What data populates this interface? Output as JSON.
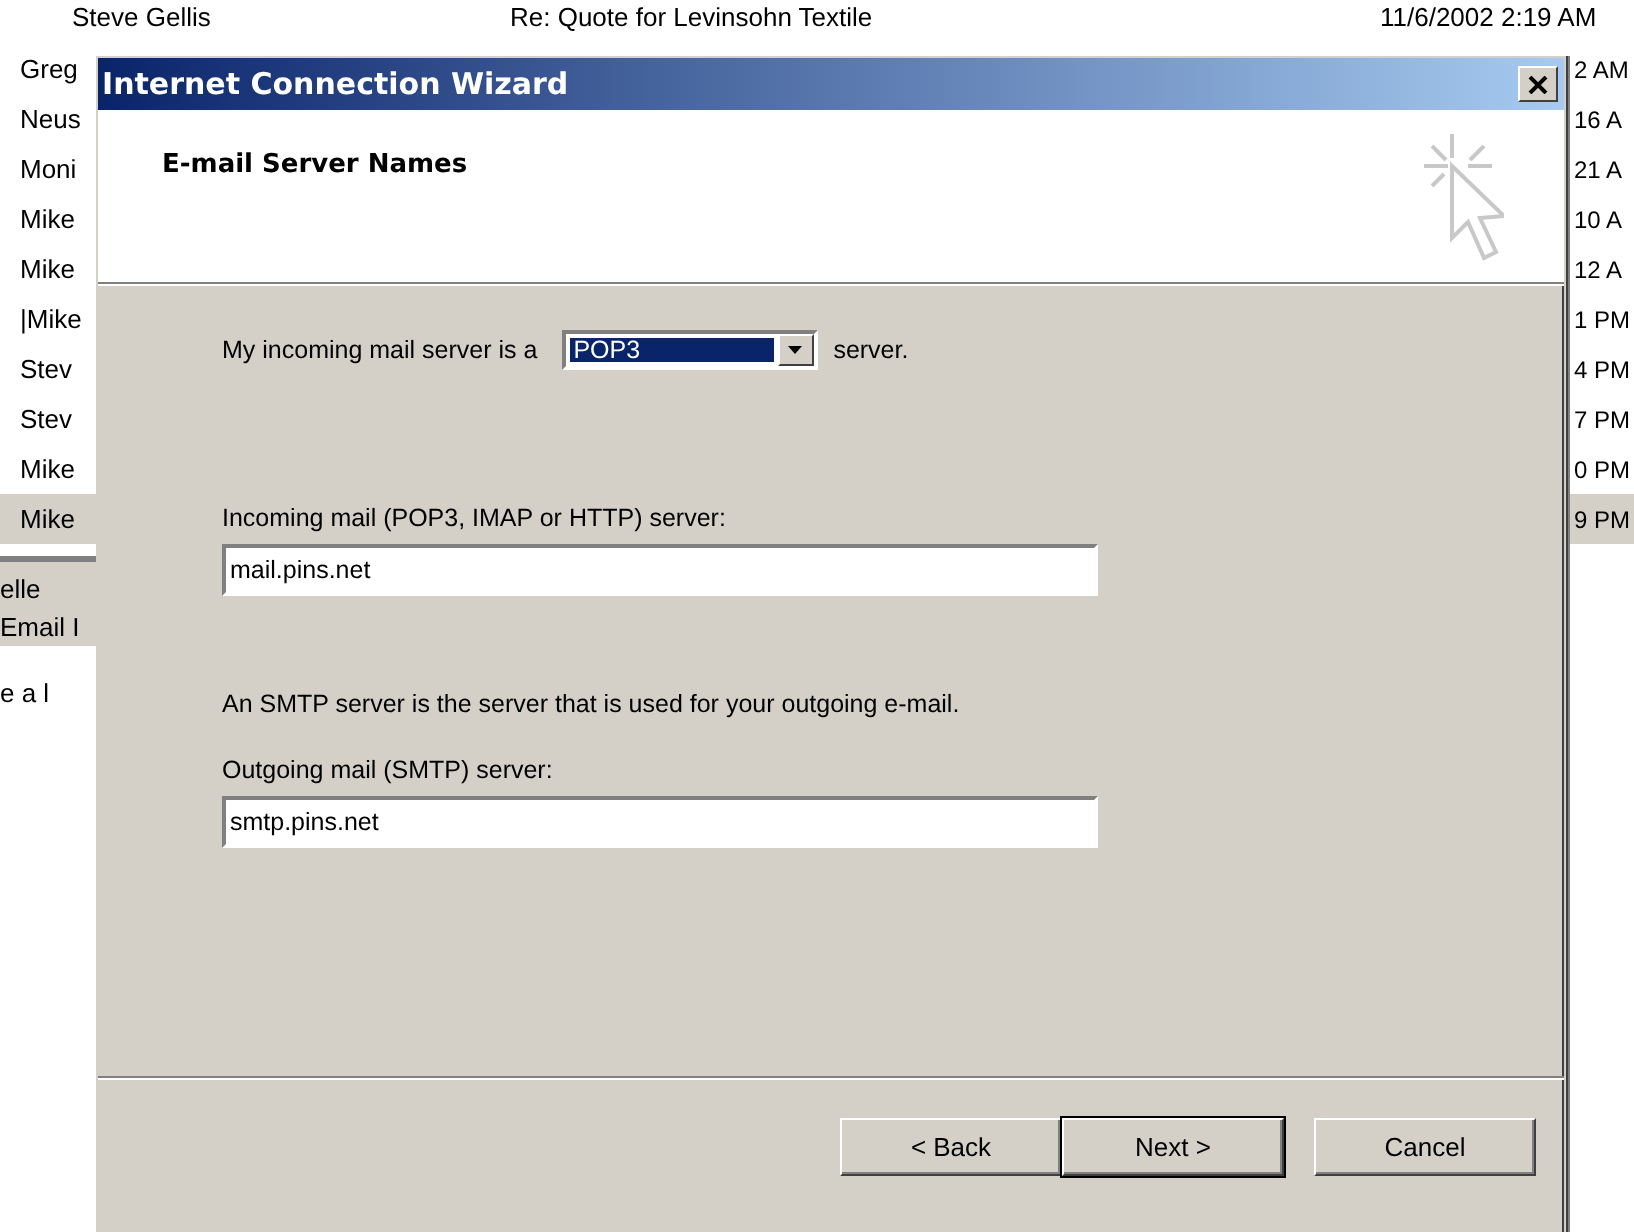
{
  "background": {
    "header_row": {
      "sender": "Steve Gellis",
      "subject": "Re: Quote for Levinsohn Textile",
      "received": "11/6/2002 2:19 AM"
    },
    "rows": [
      {
        "sender": "Greg",
        "received": "2 AM",
        "selected": false
      },
      {
        "sender": "Neus",
        "received": "16 A",
        "selected": false
      },
      {
        "sender": "Moni",
        "received": "21 A",
        "selected": false
      },
      {
        "sender": "Mike",
        "received": "10 A",
        "selected": false
      },
      {
        "sender": "Mike",
        "received": "12 A",
        "selected": false
      },
      {
        "sender": "|Mike",
        "received": "1 PM",
        "selected": false
      },
      {
        "sender": "Stev",
        "received": "4 PM",
        "selected": false
      },
      {
        "sender": "Stev",
        "received": "7 PM",
        "selected": false
      },
      {
        "sender": "Mike",
        "received": "0 PM",
        "selected": false
      },
      {
        "sender": "Mike",
        "received": "9 PM",
        "selected": true
      }
    ],
    "preview_lines": [
      "elle",
      "Email I"
    ],
    "body_text": "e a l"
  },
  "dialog": {
    "title": "Internet Connection Wizard",
    "heading": "E-mail Server Names",
    "server_type": {
      "prefix": "My incoming mail server is a",
      "value": "POP3",
      "focused": true,
      "suffix": "server."
    },
    "incoming": {
      "label": "Incoming mail (POP3, IMAP or HTTP) server:",
      "value": "mail.pins.net"
    },
    "note": "An SMTP server is the server that is used for your outgoing e-mail.",
    "outgoing": {
      "label": "Outgoing mail (SMTP) server:",
      "value": "smtp.pins.net"
    },
    "buttons": [
      {
        "label": "< Back",
        "default": false
      },
      {
        "label": "Next >",
        "default": true
      },
      {
        "label": "Cancel",
        "default": false
      }
    ]
  }
}
